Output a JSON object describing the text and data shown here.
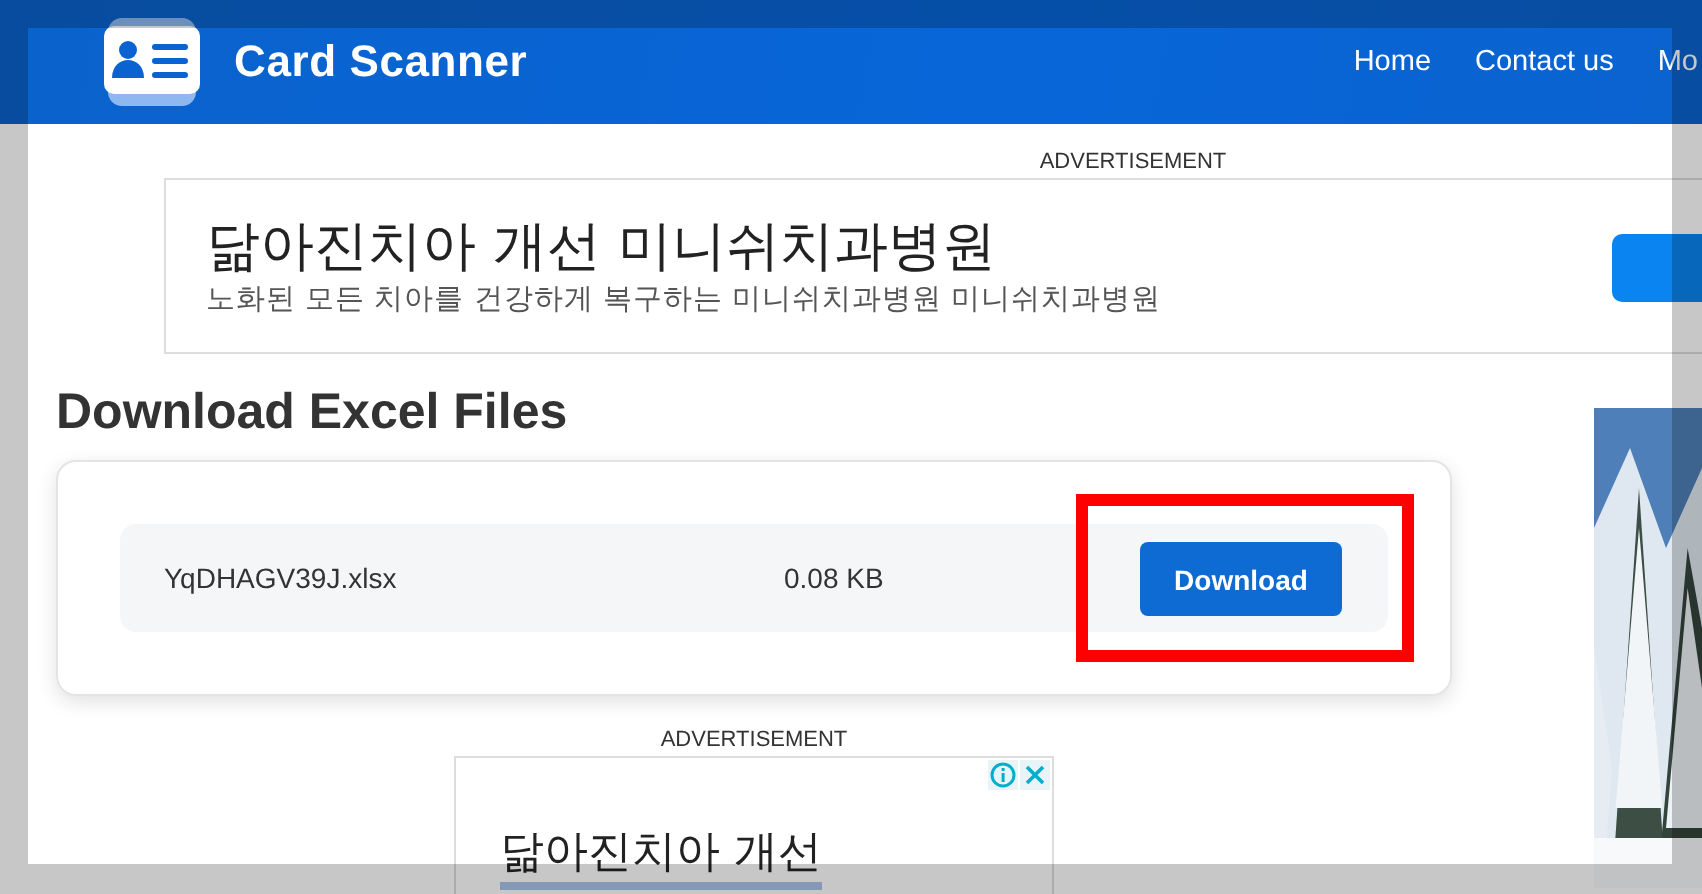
{
  "header": {
    "title": "Card Scanner",
    "nav": [
      {
        "label": "Home"
      },
      {
        "label": "Contact us"
      },
      {
        "label": "Mo"
      }
    ]
  },
  "top_ad": {
    "label": "ADVERTISEMENT",
    "title": "닮아진치아 개선 미니쉬치과병원",
    "subtitle": "노화된 모든 치아를 건강하게 복구하는 미니쉬치과병원 미니쉬치과병원"
  },
  "heading": "Download Excel Files",
  "files": [
    {
      "name": "YqDHAGV39J.xlsx",
      "size": "0.08 KB",
      "action": "Download",
      "highlighted": true
    }
  ],
  "bottom_ad": {
    "label": "ADVERTISEMENT",
    "title": "닮아진치아 개선"
  }
}
